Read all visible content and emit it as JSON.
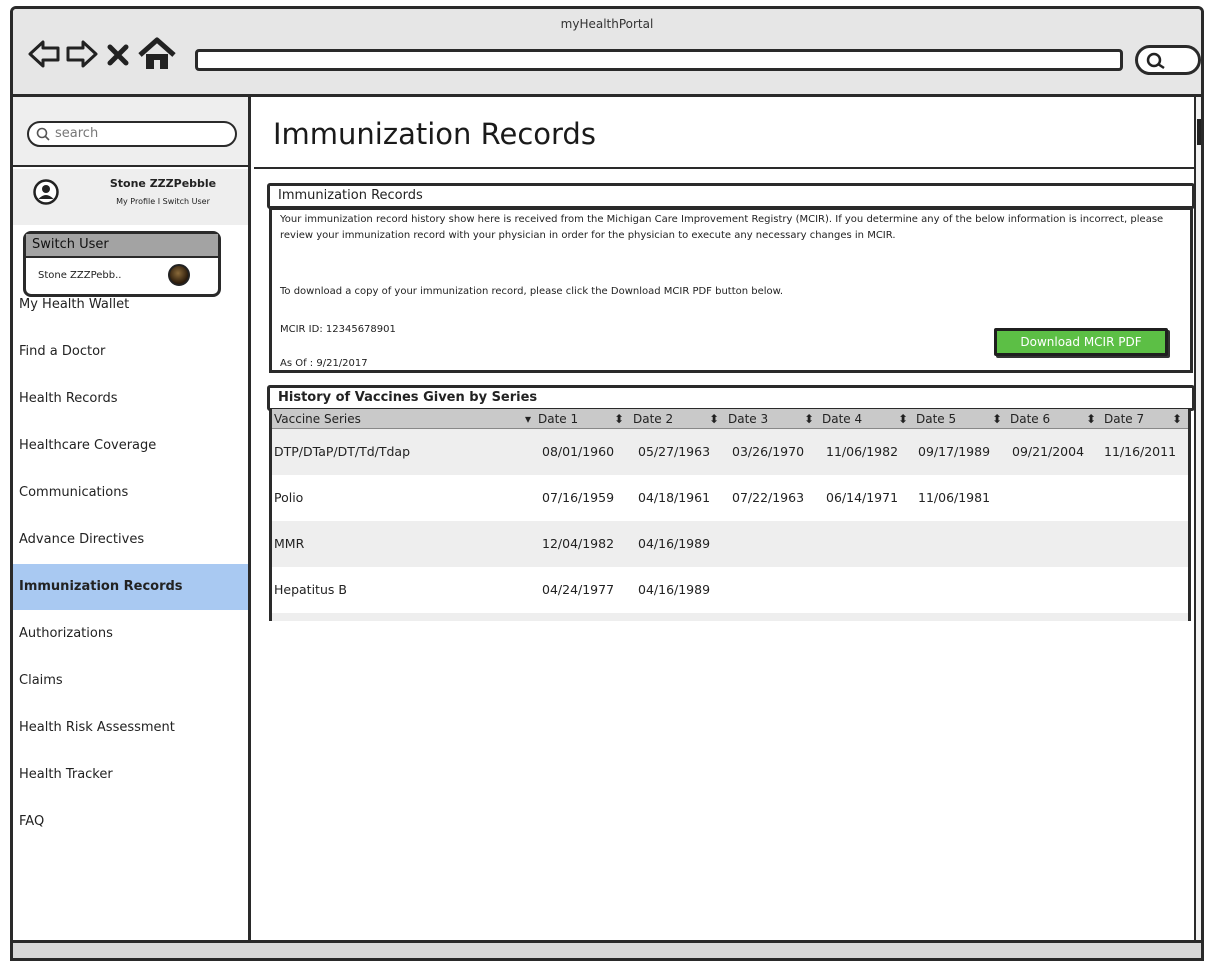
{
  "window": {
    "title": "myHealthPortal"
  },
  "sidebar": {
    "search_placeholder": "search",
    "profile": {
      "name": "Stone ZZZPebble",
      "my_profile": "My Profile",
      "separator": " I ",
      "switch_user": "Switch User"
    },
    "items": [
      {
        "label": "My Health Wallet",
        "active": false
      },
      {
        "label": "Find a Doctor",
        "active": false
      },
      {
        "label": "Health Records",
        "active": false
      },
      {
        "label": "Healthcare Coverage",
        "active": false
      },
      {
        "label": "Communications",
        "active": false
      },
      {
        "label": "Advance Directives",
        "active": false
      },
      {
        "label": "Immunization Records",
        "active": true
      },
      {
        "label": "Authorizations",
        "active": false
      },
      {
        "label": "Claims",
        "active": false
      },
      {
        "label": "Health Risk Assessment",
        "active": false
      },
      {
        "label": "Health Tracker",
        "active": false
      },
      {
        "label": "FAQ",
        "active": false
      }
    ]
  },
  "switch_user_popup": {
    "header": "Switch User",
    "user": "Stone ZZZPebb.."
  },
  "main": {
    "title": "Immunization Records",
    "records_panel": {
      "title": "Immunization Records",
      "paragraph": "Your immunization record history show here is received from the Michigan Care Improvement Registry (MCIR).  If you determine any of the below information is incorrect, please review your immunization record with your physician in order for the physician to execute any necessary changes in MCIR.",
      "download_note": "To download a copy of your immunization record, please click the Download MCIR PDF button below.",
      "mcir_id": "MCIR ID: 12345678901",
      "as_of": "As Of : 9/21/2017",
      "download_button": "Download MCIR PDF"
    },
    "history_panel": {
      "title": "History of Vaccines Given by Series",
      "columns": [
        "Vaccine Series",
        "Date 1",
        "Date 2",
        "Date 3",
        "Date 4",
        "Date 5",
        "Date 6",
        "Date 7"
      ],
      "rows": [
        {
          "series": "DTP/DTaP/DT/Td/Tdap",
          "dates": [
            "08/01/1960",
            "05/27/1963",
            "03/26/1970",
            "11/06/1982",
            "09/17/1989",
            "09/21/2004",
            "11/16/2011"
          ]
        },
        {
          "series": "Polio",
          "dates": [
            "07/16/1959",
            "04/18/1961",
            "07/22/1963",
            "06/14/1971",
            "11/06/1981",
            "",
            ""
          ]
        },
        {
          "series": "MMR",
          "dates": [
            "12/04/1982",
            "04/16/1989",
            "",
            "",
            "",
            "",
            ""
          ]
        },
        {
          "series": "Hepatitus B",
          "dates": [
            "04/24/1977",
            "04/16/1989",
            "",
            "",
            "",
            "",
            ""
          ]
        }
      ]
    }
  }
}
